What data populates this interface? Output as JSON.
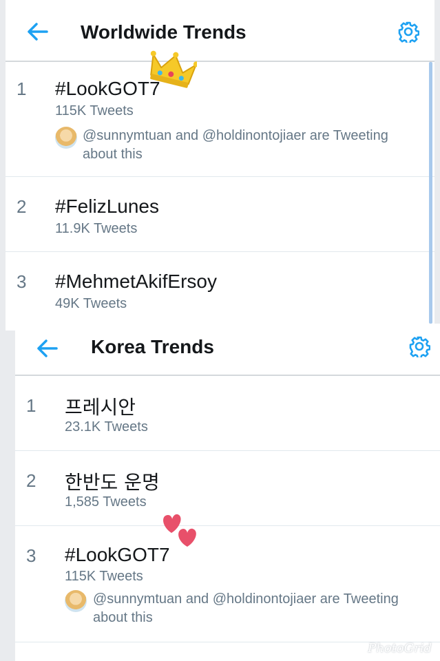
{
  "worldwide": {
    "title": "Worldwide Trends",
    "back_icon": "back-arrow-icon",
    "settings_icon": "gear-icon",
    "trends": [
      {
        "rank": "1",
        "name": "#LookGOT7",
        "count": "115K Tweets",
        "tweeting_line1": "@sunnymtuan and @holdinontojiaer are Tweeting",
        "tweeting_line2": "about this"
      },
      {
        "rank": "2",
        "name": "#FelizLunes",
        "count": "11.9K Tweets"
      },
      {
        "rank": "3",
        "name": "#MehmetAkifErsoy",
        "count": "49K Tweets"
      }
    ]
  },
  "korea": {
    "title": "Korea Trends",
    "back_icon": "back-arrow-icon",
    "settings_icon": "gear-icon",
    "trends": [
      {
        "rank": "1",
        "name": "프레시안",
        "count": "23.1K Tweets"
      },
      {
        "rank": "2",
        "name": "한반도 운명",
        "count": "1,585 Tweets"
      },
      {
        "rank": "3",
        "name": "#LookGOT7",
        "count": "115K Tweets",
        "tweeting_line1": "@sunnymtuan and @holdinontojiaer are Tweeting",
        "tweeting_line2": "about this"
      }
    ]
  },
  "decorations": {
    "crown": "crown-sticker-icon",
    "hearts": "hearts-sticker-icon"
  },
  "watermark": "PhotoGrid",
  "colors": {
    "accent": "#1da1f2",
    "text": "#14171a",
    "secondary": "#657786"
  }
}
